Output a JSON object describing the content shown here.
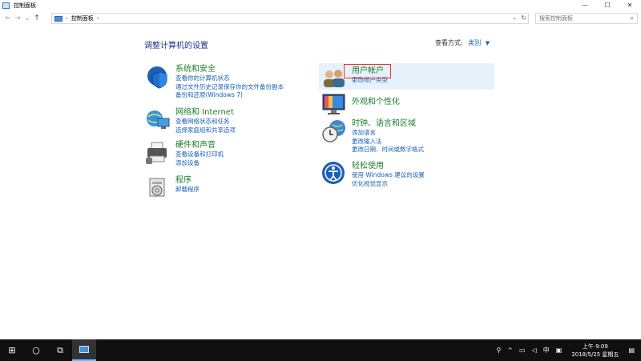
{
  "window": {
    "title": "控制面板",
    "controls": {
      "minimize": "—",
      "maximize": "☐",
      "close": "✕"
    }
  },
  "address": {
    "back": "←",
    "forward": "→",
    "recent": "⌄",
    "up": "↑",
    "breadcrumb": "控制面板",
    "separator": "›",
    "dropdown": "⌄",
    "refresh": "↻",
    "search_placeholder": "搜索控制面板",
    "search_icon": "⌕"
  },
  "content": {
    "heading": "调整计算机的设置",
    "view_by_label": "查看方式:",
    "view_by_value": "类别",
    "view_by_caret": "▼",
    "categories_left": [
      {
        "title": "系统和安全",
        "icon": "shield-icon",
        "links": [
          "查看你的计算机状态",
          "通过文件历史记录保存你的文件备份副本",
          "备份和还原(Windows 7)"
        ]
      },
      {
        "title": "网络和 Internet",
        "icon": "network-icon",
        "links": [
          "查看网络状态和任务",
          "选择家庭组和共享选项"
        ]
      },
      {
        "title": "硬件和声音",
        "icon": "printer-icon",
        "links": [
          "查看设备和打印机",
          "添加设备"
        ]
      },
      {
        "title": "程序",
        "icon": "programs-icon",
        "links": [
          "卸载程序"
        ]
      }
    ],
    "categories_right": [
      {
        "title": "用户帐户",
        "icon": "users-icon",
        "links": [
          "更改帐户类型"
        ]
      },
      {
        "title": "外观和个性化",
        "icon": "monitor-icon",
        "links": []
      },
      {
        "title": "时钟、语言和区域",
        "icon": "clock-globe-icon",
        "links": [
          "添加语言",
          "更改输入法",
          "更改日期、时间或数字格式"
        ]
      },
      {
        "title": "轻松使用",
        "icon": "accessibility-icon",
        "links": [
          "使用 Windows 建议的设置",
          "优化视觉显示"
        ]
      }
    ]
  },
  "taskbar": {
    "start_icon": "⊞",
    "search_icon": "○",
    "taskview_icon": "⧉",
    "ime": "中",
    "time": "上午 9:09",
    "date": "2018/5/25 星期五"
  }
}
